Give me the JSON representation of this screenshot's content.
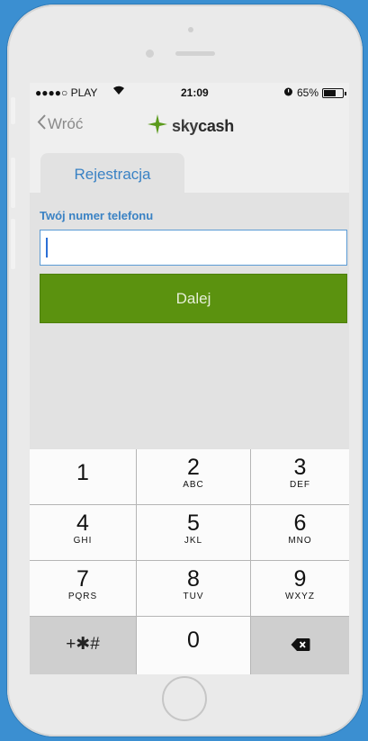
{
  "status_bar": {
    "carrier": "●●●●○ PLAY",
    "time": "21:09",
    "battery": "65%",
    "battery_level": 0.65
  },
  "nav": {
    "back_label": "Wróć",
    "logo_prefix": "sky",
    "logo_suffix": "cash"
  },
  "tabs": [
    {
      "label": "Rejestracja"
    }
  ],
  "form": {
    "phone_label": "Twój numer telefonu",
    "phone_value": "",
    "next_label": "Dalej"
  },
  "keypad": {
    "keys": [
      {
        "num": "1",
        "letters": ""
      },
      {
        "num": "2",
        "letters": "ABC"
      },
      {
        "num": "3",
        "letters": "DEF"
      },
      {
        "num": "4",
        "letters": "GHI"
      },
      {
        "num": "5",
        "letters": "JKL"
      },
      {
        "num": "6",
        "letters": "MNO"
      },
      {
        "num": "7",
        "letters": "PQRS"
      },
      {
        "num": "8",
        "letters": "TUV"
      },
      {
        "num": "9",
        "letters": "WXYZ"
      }
    ],
    "symbols_label": "+✱#",
    "zero": "0"
  },
  "colors": {
    "accent": "#3a82c4",
    "button_green": "#5b920f",
    "background": "#3b8fd1"
  }
}
